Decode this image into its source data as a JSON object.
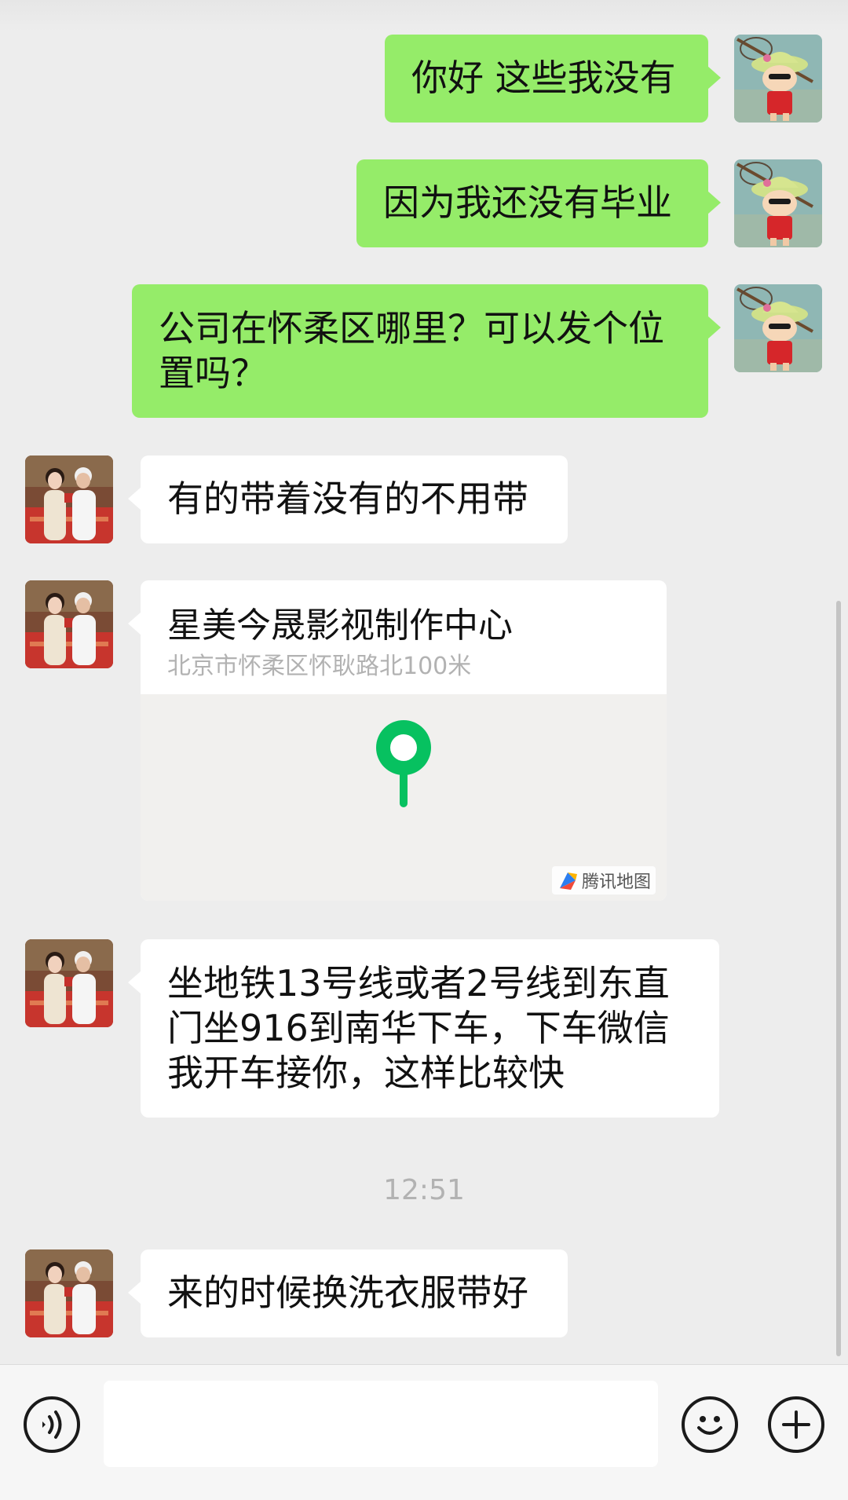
{
  "messages": [
    {
      "sender": "me",
      "text": "你好 这些我没有"
    },
    {
      "sender": "me",
      "text": "因为我还没有毕业"
    },
    {
      "sender": "me",
      "text": "公司在怀柔区哪里？可以发个位置吗？"
    },
    {
      "sender": "them",
      "text": "有的带着没有的不用带"
    },
    {
      "sender": "them",
      "type": "location",
      "name": "星美今晟影视制作中心",
      "address": "北京市怀柔区怀耿路北100米",
      "map_brand": "腾讯地图"
    },
    {
      "sender": "them",
      "text": "坐地铁13号线或者2号线到东直门坐916到南华下车，下车微信我开车接你，这样比较快"
    },
    {
      "sender": "them",
      "text": "来的时候换洗衣服带好"
    }
  ],
  "time_divider": "12:51",
  "input": {
    "value": "",
    "placeholder": ""
  },
  "icons": {
    "voice": "voice-icon",
    "emoji": "emoji-icon",
    "plus": "plus-icon",
    "map_pin": "map-pin-icon"
  },
  "colors": {
    "background": "#ededed",
    "my_bubble": "#95ec69",
    "their_bubble": "#ffffff",
    "pin_green": "#07c160",
    "timestamp": "#b2b2b2"
  }
}
